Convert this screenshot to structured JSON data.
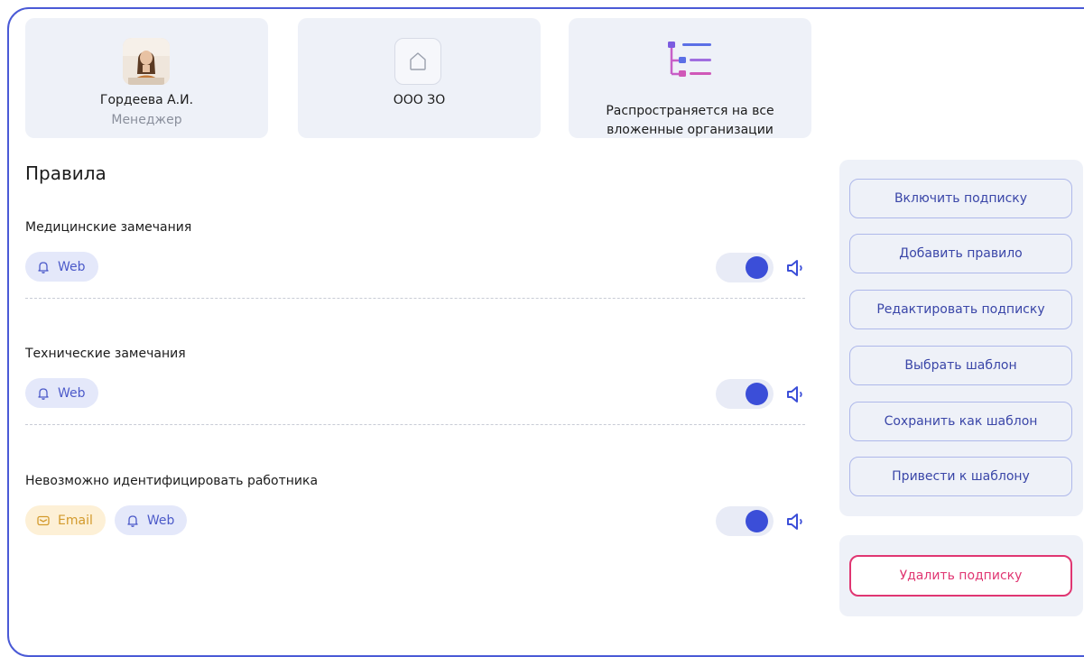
{
  "cards": {
    "user": {
      "name": "Гордеева А.И.",
      "role": "Менеджер"
    },
    "org": {
      "name": "ООО ЗО"
    },
    "scope": {
      "text": "Распространяется на все\nвложенные организации"
    }
  },
  "rules": {
    "title": "Правила",
    "items": [
      {
        "name": "Медицинские замечания",
        "channels": [
          "Web"
        ],
        "enabled": true
      },
      {
        "name": "Технические замечания",
        "channels": [
          "Web"
        ],
        "enabled": true
      },
      {
        "name": "Невозможно идентифицировать работника",
        "channels": [
          "Email",
          "Web"
        ],
        "enabled": true
      }
    ]
  },
  "actions": {
    "enable_subscription": "Включить подписку",
    "add_rule": "Добавить правило",
    "edit_subscription": "Редактировать подписку",
    "choose_template": "Выбрать шаблон",
    "save_as_template": "Сохранить как шаблон",
    "apply_template": "Привести к шаблону",
    "delete_subscription": "Удалить подписку"
  },
  "colors": {
    "accent": "#3b4ed8",
    "danger": "#e03672",
    "panel": "#eef1f8"
  },
  "icons": {
    "org": "home-icon",
    "scope": "tree-structure-icon",
    "web": "bell-icon",
    "email": "mail-icon",
    "sound": "speaker-icon"
  }
}
